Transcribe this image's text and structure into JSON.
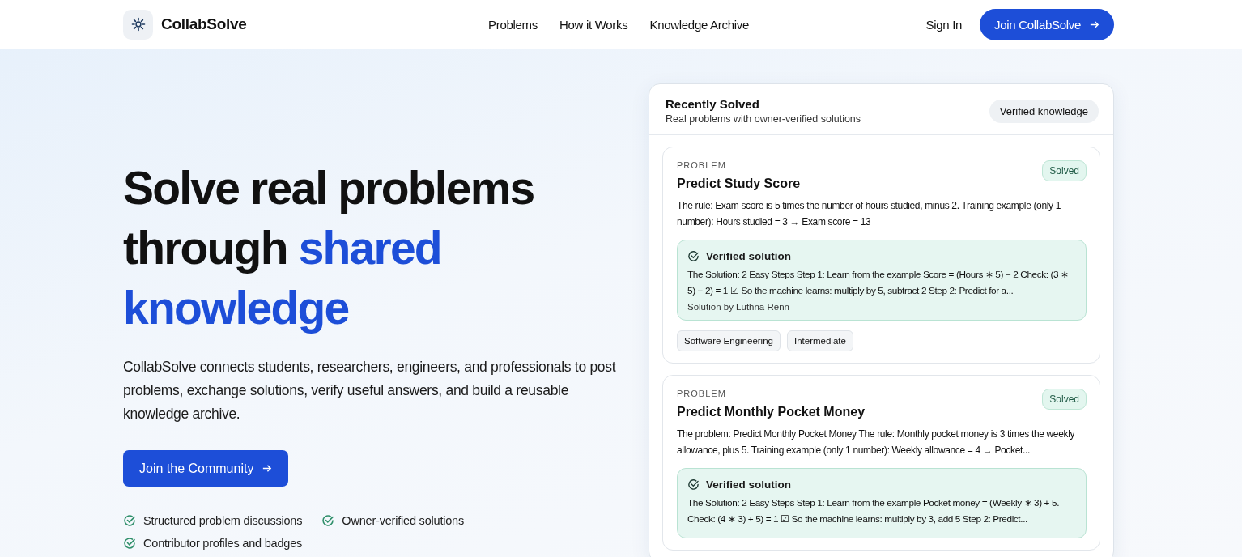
{
  "brand": {
    "name": "CollabSolve"
  },
  "nav": {
    "links": [
      "Problems",
      "How it Works",
      "Knowledge Archive"
    ],
    "sign_in": "Sign In",
    "cta": "Join CollabSolve"
  },
  "hero": {
    "title_start": "Solve real problems through",
    "title_highlight": "shared knowledge",
    "description": "CollabSolve connects students, researchers, engineers, and professionals to post problems, exchange solutions, verify useful answers, and build a reusable knowledge archive.",
    "cta": "Join the Community",
    "features": [
      "Structured problem discussions",
      "Owner-verified solutions",
      "Contributor profiles and badges"
    ]
  },
  "panel": {
    "title": "Recently Solved",
    "subtitle": "Real problems with owner-verified solutions",
    "badge": "Verified knowledge",
    "problems": [
      {
        "eyebrow": "PROBLEM",
        "title": "Predict Study Score",
        "status": "Solved",
        "solved": true,
        "body": "The rule: Exam score is 5 times the number of hours studied, minus 2. Training example (only 1 number): Hours studied = 3 → Exam score = 13",
        "solution_label": "Verified solution",
        "solution": "The Solution: 2 Easy Steps Step 1: Learn from the example Score = (Hours ∗ 5) − 2 Check: (3 ∗ 5) − 2) = 1 ☑ So the machine learns: multiply by 5, subtract 2 Step 2: Predict for a...",
        "author": "Solution by Luthna Renn",
        "tags": [
          "Software Engineering",
          "Intermediate"
        ]
      },
      {
        "eyebrow": "PROBLEM",
        "title": "Predict Monthly Pocket Money",
        "status": "Solved",
        "solved": true,
        "body": "The problem: Predict Monthly Pocket Money The rule: Monthly pocket money is 3 times the weekly allowance, plus 5. Training example (only 1 number): Weekly allowance = 4 → Pocket...",
        "solution_label": "Verified solution",
        "solution": "The Solution: 2 Easy Steps Step 1: Learn from the example Pocket money = (Weekly ∗ 3) + 5. Check: (4 ∗ 3) + 5) = 1 ☑ So the machine learns: multiply by 3, add 5 Step 2: Predict..."
      }
    ]
  }
}
